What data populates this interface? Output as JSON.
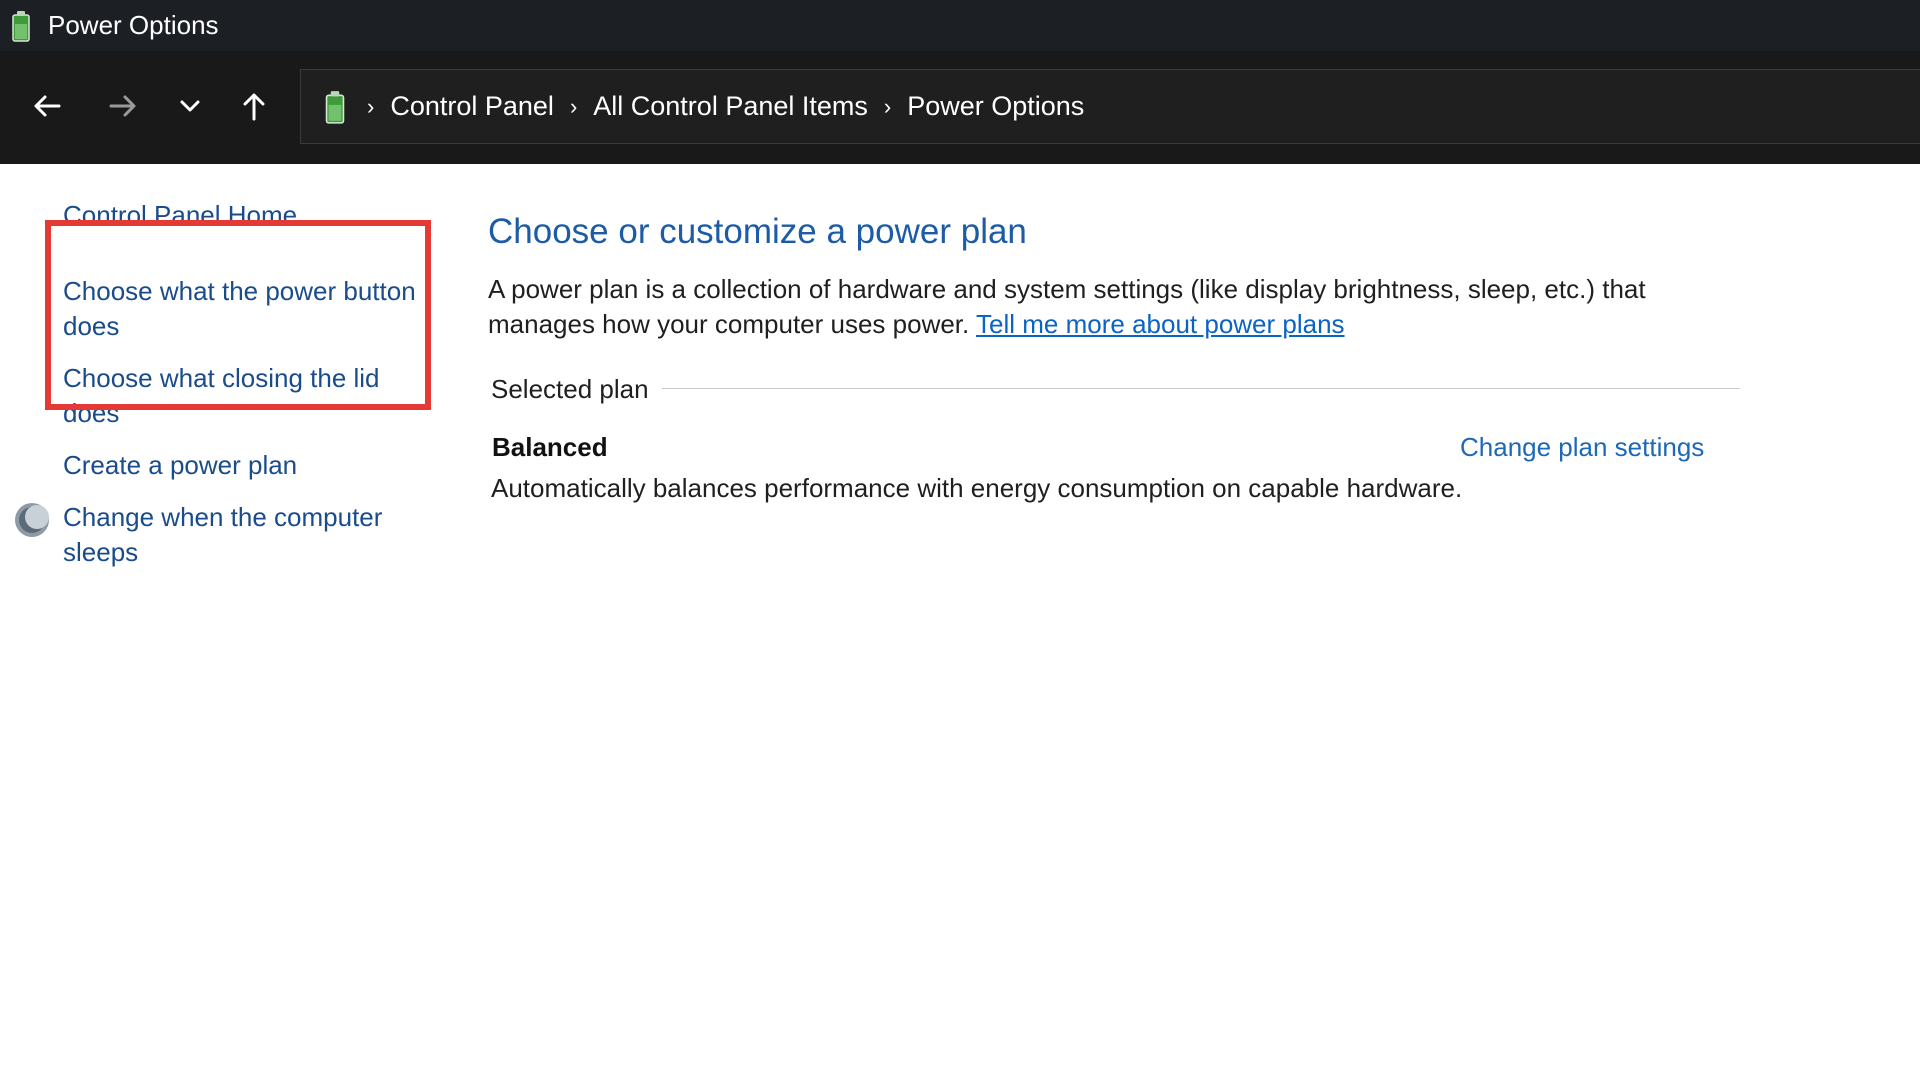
{
  "window": {
    "title": "Power Options",
    "app_icon": "power-options-battery-icon"
  },
  "navigation": {
    "back_icon": "back-arrow-icon",
    "forward_icon": "forward-arrow-icon",
    "recent_icon": "chevron-down-icon",
    "up_icon": "up-arrow-icon",
    "breadcrumbs": [
      "Control Panel",
      "All Control Panel Items",
      "Power Options"
    ],
    "separator": "›"
  },
  "sidebar": {
    "home": "Control Panel Home",
    "items": [
      "Choose what the power button does",
      "Choose what closing the lid does",
      "Create a power plan",
      "Change when the computer sleeps"
    ],
    "highlight_color": "#e53935"
  },
  "main": {
    "heading": "Choose or customize a power plan",
    "description": "A power plan is a collection of hardware and system settings (like display brightness, sleep, etc.) that manages how your computer uses power.",
    "learn_more": "Tell me more about power plans",
    "section_label": "Selected plan",
    "plan": {
      "name": "Balanced",
      "change_link": "Change plan settings",
      "description": "Automatically balances performance with energy consumption on capable hardware."
    }
  },
  "colors": {
    "titlebar": "#1c1f24",
    "navbar": "#191919",
    "link": "#1a4c8c",
    "heading": "#1c5ba6"
  }
}
